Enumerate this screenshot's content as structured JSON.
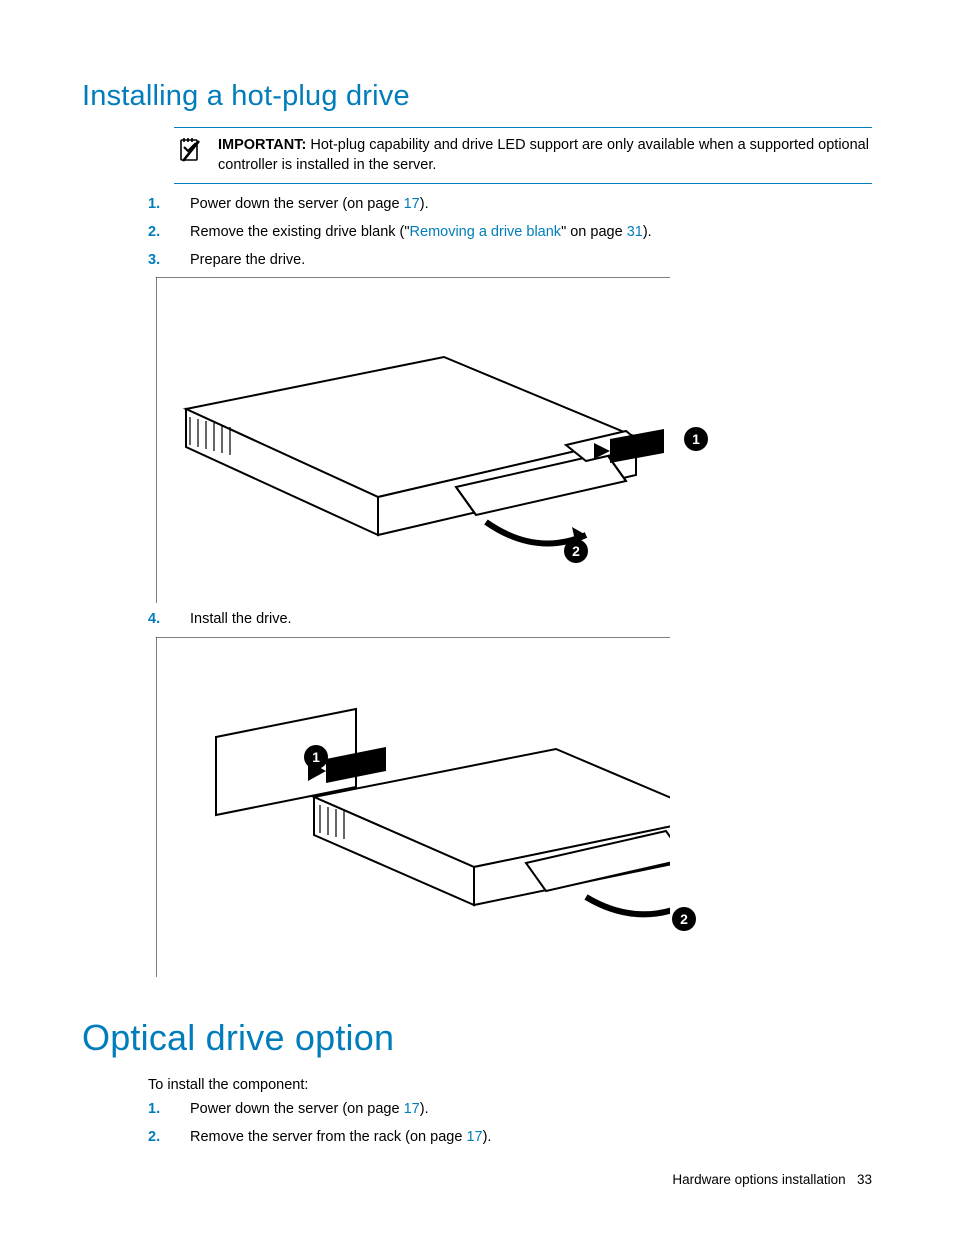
{
  "section1": {
    "title": "Installing a hot-plug drive",
    "callout": {
      "label": "IMPORTANT:",
      "text": "Hot-plug capability and drive LED support are only available when a supported optional controller is installed in the server."
    },
    "steps": {
      "s1_num": "1.",
      "s1_a": "Power down the server (on page ",
      "s1_link": "17",
      "s1_b": ").",
      "s2_num": "2.",
      "s2_a": "Remove the existing drive blank (\"",
      "s2_link1": "Removing a drive blank",
      "s2_b": "\" on page ",
      "s2_link2": "31",
      "s2_c": ").",
      "s3_num": "3.",
      "s3_text": "Prepare the drive.",
      "s4_num": "4.",
      "s4_text": "Install the drive."
    }
  },
  "section2": {
    "title": "Optical drive option",
    "intro": "To install the component:",
    "steps": {
      "s1_num": "1.",
      "s1_a": "Power down the server (on page ",
      "s1_link": "17",
      "s1_b": ").",
      "s2_num": "2.",
      "s2_a": "Remove the server from the rack (on page ",
      "s2_link": "17",
      "s2_b": ")."
    }
  },
  "footer": {
    "section": "Hardware options installation",
    "page": "33"
  }
}
